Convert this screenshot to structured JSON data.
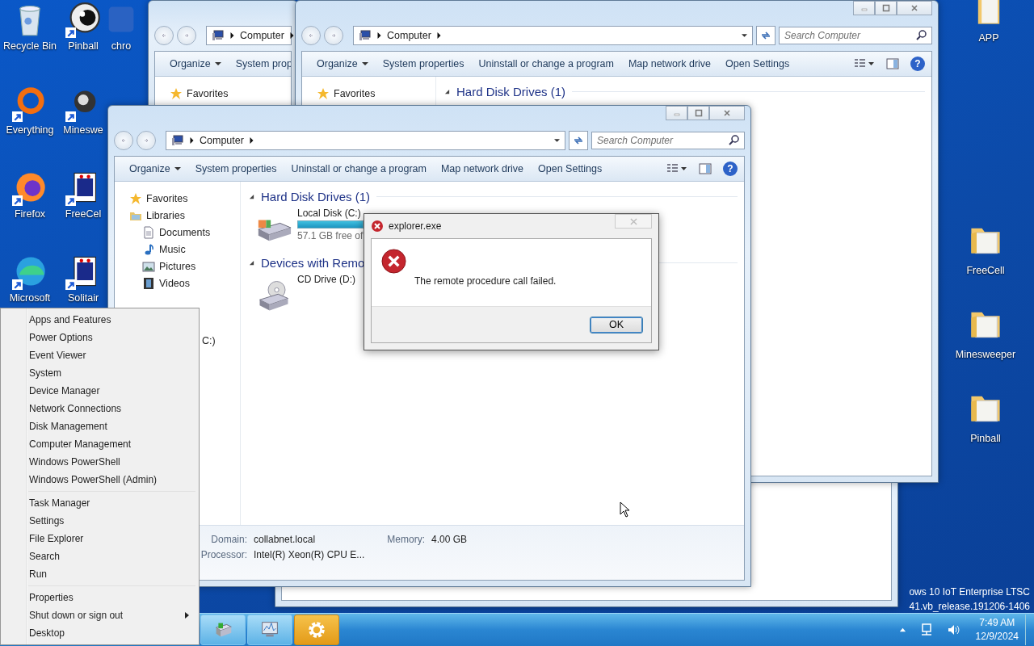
{
  "desktop": {
    "left_icons": [
      {
        "label": "Recycle Bin",
        "kind": "recycle-bin",
        "shortcut": false
      },
      {
        "label": "Everything",
        "kind": "ring",
        "shortcut": true
      },
      {
        "label": "Firefox",
        "kind": "firefox",
        "shortcut": true
      },
      {
        "label": "Microsoft",
        "kind": "edge",
        "shortcut": true
      },
      {
        "label": "Pinball",
        "kind": "ball",
        "shortcut": true
      },
      {
        "label": "Mineswe",
        "kind": "mine",
        "shortcut": true
      },
      {
        "label": "FreeCel",
        "kind": "cards",
        "shortcut": true
      },
      {
        "label": "Solitair",
        "kind": "cards",
        "shortcut": true
      },
      {
        "label": "chro",
        "kind": "blank",
        "shortcut": false
      }
    ],
    "right_icons": [
      {
        "label": "APP",
        "kind": "app"
      },
      {
        "label": "FreeCell",
        "kind": "folder"
      },
      {
        "label": "Minesweeper",
        "kind": "folder"
      },
      {
        "label": "Pinball",
        "kind": "folder"
      }
    ],
    "watermark": [
      "ows 10 IoT Enterprise LTSC",
      "41.vb_release.191206-1406"
    ]
  },
  "windows": [
    {
      "caption_buttons": false,
      "breadcrumb": "Computer",
      "toolbar": [
        {
          "label": "Organize",
          "dropdown": true
        },
        {
          "label": "System prop",
          "dropdown": false
        }
      ],
      "view_icons": false,
      "sidebar": [
        {
          "label": "Favorites",
          "kind": "star"
        }
      ]
    },
    {
      "caption_buttons": true,
      "breadcrumb": "Computer",
      "search": {
        "placeholder": "Search Computer"
      },
      "toolbar": [
        {
          "label": "Organize",
          "dropdown": true
        },
        {
          "label": "System properties",
          "dropdown": false
        },
        {
          "label": "Uninstall or change a program",
          "dropdown": false
        },
        {
          "label": "Map network drive",
          "dropdown": false
        },
        {
          "label": "Open Settings",
          "dropdown": false
        }
      ],
      "view_icons": true,
      "help": "?",
      "sidebar": [
        {
          "label": "Favorites",
          "kind": "star"
        }
      ],
      "sections": [
        {
          "title": "Hard Disk Drives (1)"
        }
      ]
    },
    {
      "caption_buttons": true,
      "breadcrumb": "Computer",
      "search": {
        "placeholder": "Search Computer"
      },
      "toolbar": [
        {
          "label": "Organize",
          "dropdown": true
        },
        {
          "label": "System properties",
          "dropdown": false
        },
        {
          "label": "Uninstall or change a program",
          "dropdown": false
        },
        {
          "label": "Map network drive",
          "dropdown": false
        },
        {
          "label": "Open Settings",
          "dropdown": false
        }
      ],
      "view_icons": true,
      "help": "?",
      "sidebar": [
        {
          "label": "Favorites",
          "kind": "star"
        },
        {
          "label": "Libraries",
          "kind": "library",
          "children": [
            {
              "label": "Documents",
              "kind": "document"
            },
            {
              "label": "Music",
              "kind": "music"
            },
            {
              "label": "Pictures",
              "kind": "picture"
            },
            {
              "label": "Videos",
              "kind": "film"
            }
          ]
        },
        {
          "label": "C:)",
          "kind": "none"
        }
      ],
      "sections": [
        {
          "title": "Hard Disk Drives (1)",
          "items": [
            {
              "kind": "hdd",
              "name": "Local Disk (C:)",
              "detail": "57.1 GB free of"
            }
          ]
        },
        {
          "title": "Devices with Remo",
          "items": [
            {
              "kind": "cd",
              "name": "CD Drive (D:)"
            }
          ]
        }
      ],
      "details": [
        {
          "label": "Domain:",
          "value": "collabnet.local"
        },
        {
          "label": "Memory:",
          "value": "4.00 GB"
        },
        {
          "label": "Processor:",
          "value": "Intel(R) Xeon(R) CPU E..."
        }
      ]
    }
  ],
  "dialog": {
    "title": "explorer.exe",
    "message": "The remote procedure call failed.",
    "button": {
      "label": "OK",
      "default": true
    }
  },
  "context_menu": {
    "groups": [
      [
        {
          "label": "Apps and Features",
          "submenu": false
        },
        {
          "label": "Power Options",
          "submenu": false
        },
        {
          "label": "Event Viewer",
          "submenu": false
        },
        {
          "label": "System",
          "submenu": false
        },
        {
          "label": "Device Manager",
          "submenu": false
        },
        {
          "label": "Network Connections",
          "submenu": false
        },
        {
          "label": "Disk Management",
          "submenu": false
        },
        {
          "label": "Computer Management",
          "submenu": false
        },
        {
          "label": "Windows PowerShell",
          "submenu": false
        },
        {
          "label": "Windows PowerShell (Admin)",
          "submenu": false
        }
      ],
      [
        {
          "label": "Task Manager",
          "submenu": false
        },
        {
          "label": "Settings",
          "submenu": false
        },
        {
          "label": "File Explorer",
          "submenu": false
        },
        {
          "label": "Search",
          "submenu": false
        },
        {
          "label": "Run",
          "submenu": false
        }
      ],
      [
        {
          "label": "Properties",
          "submenu": false
        },
        {
          "label": "Shut down or sign out",
          "submenu": true
        },
        {
          "label": "Desktop",
          "submenu": false
        }
      ]
    ]
  },
  "taskbar": {
    "buttons": [
      {
        "kind": "computer",
        "active": false
      },
      {
        "kind": "monitor",
        "active": false
      },
      {
        "kind": "gear",
        "active": true
      }
    ],
    "time": "7:49 AM",
    "date": "12/9/2024"
  }
}
